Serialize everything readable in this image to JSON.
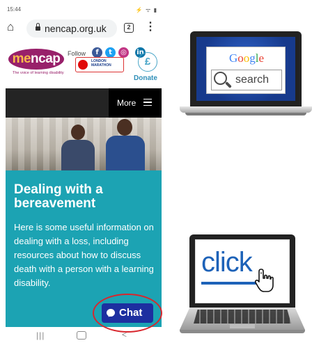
{
  "status_bar": {
    "time": "15:44",
    "icons": "⚡ ᯤ ▮"
  },
  "browser": {
    "url": "nencap.org.uk",
    "tab_count": "2",
    "menu_icon": "⋮"
  },
  "site": {
    "logo_text_main": "me",
    "logo_text_rest": "ncap",
    "logo_tagline": "The voice of learning disability",
    "follow_label": "Follow",
    "social": [
      "f",
      "t",
      "◎",
      "in"
    ],
    "marathon_badge": "LONDON MARATHON",
    "donate_symbol": "£",
    "donate_label": "Donate",
    "nav_more": "More"
  },
  "article": {
    "title": "Dealing with a bereavement",
    "body": "Here is some useful information on dealing with a loss, including resources about how to discuss death with a person with a learning disability."
  },
  "chat": {
    "label": "Chat",
    "highlight_color": "#d8262d",
    "button_color": "#1d2fa0"
  },
  "colors": {
    "brand_purple": "#98206a",
    "card_teal": "#1ca3b3",
    "nav_dark": "#242424"
  },
  "android_nav": {
    "recents": "|||",
    "back": "<"
  },
  "illustration_google": {
    "logo": "Google",
    "search_label": "search"
  },
  "illustration_click": {
    "word": "click"
  }
}
